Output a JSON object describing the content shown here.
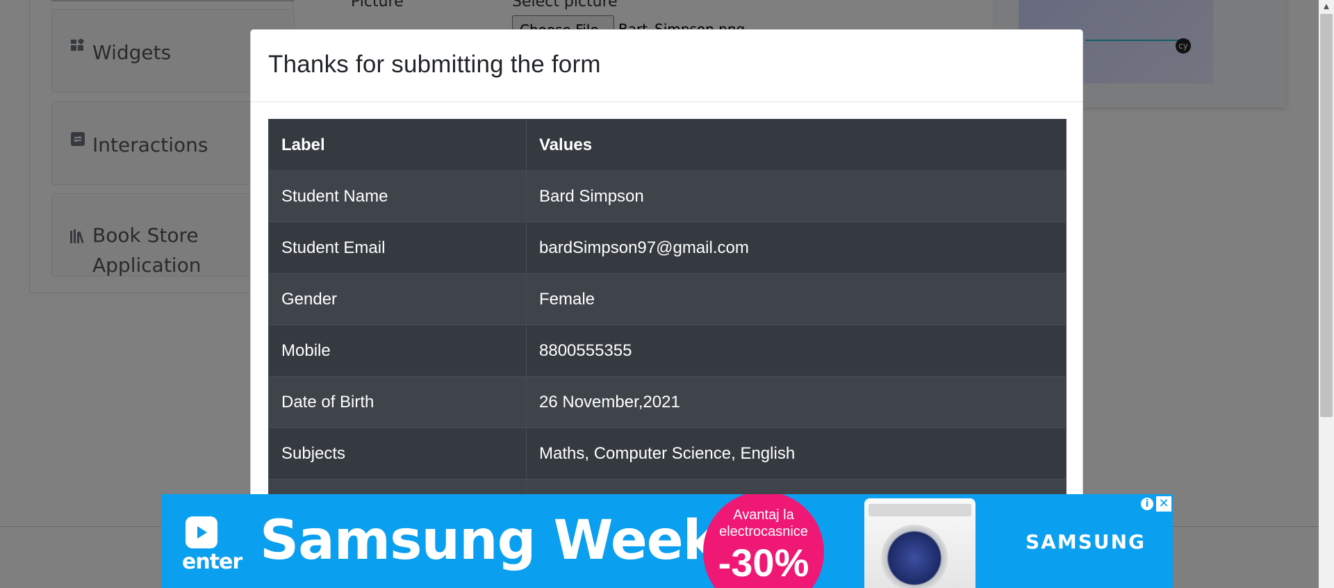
{
  "background_page": {
    "sidebar_groups": [
      {
        "label": "Widgets",
        "icon": "widgets-icon"
      },
      {
        "label": "Interactions",
        "icon": "interactions-icon"
      },
      {
        "label": "Book Store Application",
        "icon": "books-icon"
      }
    ],
    "form": {
      "picture_label": "Picture",
      "picture_hint": "Select picture",
      "file_button_label": "Choose File",
      "file_name": "Bart_Simpson.png"
    },
    "promo_badge": "cy"
  },
  "modal": {
    "title": "Thanks for submitting the form",
    "table": {
      "headers": [
        "Label",
        "Values"
      ],
      "rows": [
        {
          "label": "Student Name",
          "value": "Bard Simpson"
        },
        {
          "label": "Student Email",
          "value": "bardSimpson97@gmail.com"
        },
        {
          "label": "Gender",
          "value": "Female"
        },
        {
          "label": "Mobile",
          "value": "8800555355"
        },
        {
          "label": "Date of Birth",
          "value": "26 November,2021"
        },
        {
          "label": "Subjects",
          "value": "Maths, Computer Science, English"
        }
      ]
    }
  },
  "ad": {
    "logo_text": "enter",
    "headline": "Samsung Week",
    "discount_line1": "Avantaj la",
    "discount_line2": "electrocasnice",
    "discount_value": "-30%",
    "brand": "SAMSUNG",
    "info_icon": "info-icon",
    "close_icon": "close-icon",
    "colors": {
      "background": "#0b9ff0",
      "badge": "#ef1874"
    }
  },
  "colors": {
    "table_header_bg": "#343a40",
    "table_row_odd": "#3e444a",
    "table_row_even": "#343a40",
    "overlay": "rgba(0,0,0,0.5)"
  }
}
